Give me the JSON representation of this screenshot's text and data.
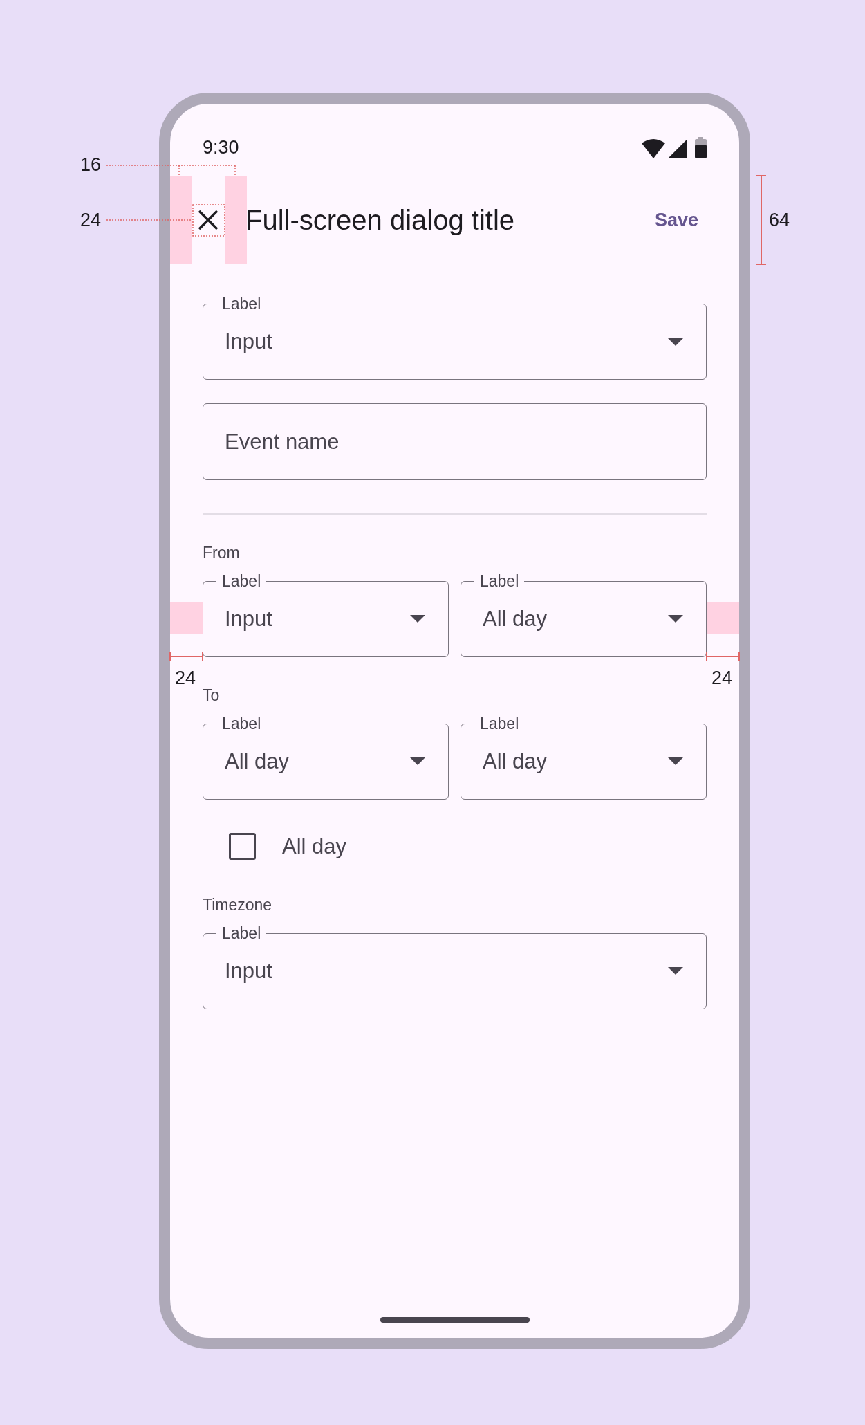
{
  "status_bar": {
    "time": "9:30"
  },
  "app_bar": {
    "title": "Full-screen dialog title",
    "action": "Save"
  },
  "top_fields": [
    {
      "kind": "dropdown",
      "label": "Label",
      "value": "Input"
    },
    {
      "kind": "text",
      "placeholder": "Event name"
    }
  ],
  "from": {
    "heading": "From",
    "fields": [
      {
        "kind": "dropdown",
        "label": "Label",
        "value": "Input"
      },
      {
        "kind": "dropdown",
        "label": "Label",
        "value": "All day"
      }
    ]
  },
  "to": {
    "heading": "To",
    "fields": [
      {
        "kind": "dropdown",
        "label": "Label",
        "value": "All day"
      },
      {
        "kind": "dropdown",
        "label": "Label",
        "value": "All day"
      }
    ]
  },
  "all_day": {
    "label": "All day",
    "checked": false
  },
  "timezone": {
    "heading": "Timezone",
    "fields": [
      {
        "kind": "dropdown",
        "label": "Label",
        "value": "Input"
      }
    ]
  },
  "annotations": [
    {
      "kind": "icon-gap",
      "label": "16"
    },
    {
      "kind": "icon-size",
      "label": "24"
    },
    {
      "kind": "bar-height",
      "label": "64"
    },
    {
      "kind": "margin-start",
      "label": "24"
    },
    {
      "kind": "margin-end",
      "label": "24"
    }
  ]
}
